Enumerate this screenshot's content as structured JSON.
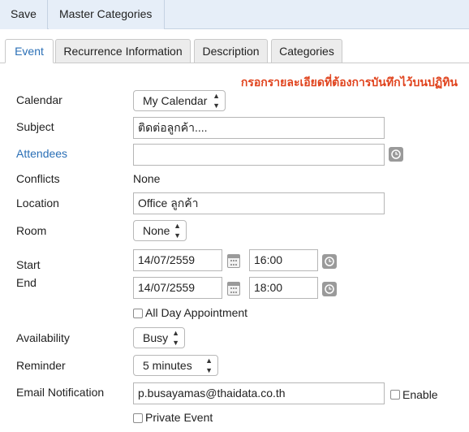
{
  "toolbar": {
    "save_label": "Save",
    "master_categories_label": "Master Categories"
  },
  "tabs": [
    {
      "label": "Event"
    },
    {
      "label": "Recurrence Information"
    },
    {
      "label": "Description"
    },
    {
      "label": "Categories"
    }
  ],
  "note": "กรอกรายละเอียดที่ต้องการบันทึกไว้บนปฏิทิน",
  "form": {
    "calendar": {
      "label": "Calendar",
      "value": "My Calendar"
    },
    "subject": {
      "label": "Subject",
      "value": "ติดต่อลูกค้า...."
    },
    "attendees": {
      "label": "Attendees",
      "value": ""
    },
    "conflicts": {
      "label": "Conflicts",
      "value": "None"
    },
    "location": {
      "label": "Location",
      "value": "Office ลูกค้า"
    },
    "room": {
      "label": "Room",
      "value": "None"
    },
    "start": {
      "label": "Start",
      "date": "14/07/2559",
      "time": "16:00"
    },
    "end": {
      "label": "End",
      "date": "14/07/2559",
      "time": "18:00"
    },
    "all_day": {
      "label": "All Day Appointment",
      "checked": false
    },
    "availability": {
      "label": "Availability",
      "value": "Busy"
    },
    "reminder": {
      "label": "Reminder",
      "value": "5 minutes"
    },
    "email_notification": {
      "label": "Email Notification",
      "value": "p.busayamas@thaidata.co.th",
      "enable_label": "Enable",
      "enable_checked": false
    },
    "private_event": {
      "label": "Private Event",
      "checked": false
    }
  },
  "icons": {
    "clock": "clock-icon",
    "calendar": "calendar-icon",
    "select_arrows": "up-down-arrows-icon"
  },
  "colors": {
    "toolbar_bg": "#e6eef8",
    "accent": "#2a6fb6",
    "note": "#e0431d",
    "icon_gray": "#9a9a9a"
  }
}
